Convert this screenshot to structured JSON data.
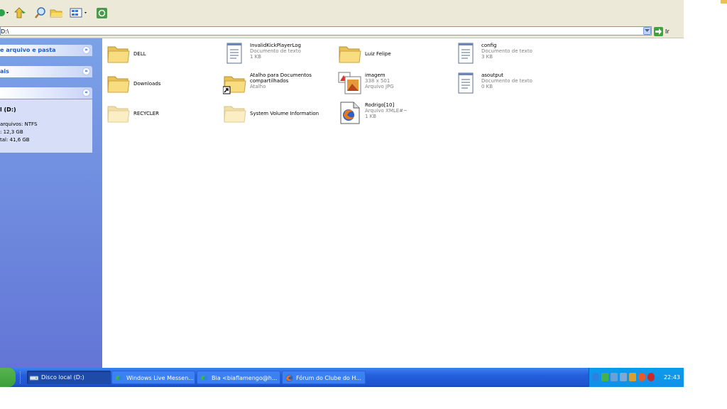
{
  "address": {
    "value": "D:\\",
    "go_label": "Ir"
  },
  "taskpane": {
    "panel1": "e arquivo e pasta",
    "panel2": "ais",
    "details": {
      "title": "l (D:)",
      "lines": [
        "arquivos: NTFS",
        ": 12,3 GB",
        "tal: 41,6 GB"
      ]
    }
  },
  "files": [
    {
      "name": "DELL",
      "icon": "folder-icon"
    },
    {
      "name": "Downloads",
      "icon": "folder-icon"
    },
    {
      "name": "RECYCLER",
      "icon": "folder-icon-faded"
    },
    {
      "name": "InvalidKickPlayerLog",
      "type": "Documento de texto",
      "size": "1 KB",
      "icon": "text-document-icon"
    },
    {
      "name": "Atalho para Documentos",
      "name2": "compartilhados",
      "type": "Atalho",
      "icon": "shortcut-folder-icon"
    },
    {
      "name": "System Volume Information",
      "icon": "folder-icon-faded"
    },
    {
      "name": "Luiz Felipe",
      "icon": "folder-icon"
    },
    {
      "name": "imagem",
      "type": "338 x 501",
      "size": "Arquivo JPG",
      "icon": "jpg-image-icon"
    },
    {
      "name": "Rodrigo[10]",
      "type": "Arquivo XMLE#~",
      "size": "1 KB",
      "icon": "firefox-document-icon"
    },
    {
      "name": "config",
      "type": "Documento de texto",
      "size": "3 KB",
      "icon": "text-document-icon"
    },
    {
      "name": "asoutput",
      "type": "Documento de texto",
      "size": "0 KB",
      "icon": "text-document-icon"
    }
  ],
  "taskbar": {
    "tasks": [
      {
        "label": "Disco local (D:)"
      },
      {
        "label": "Windows Live Messen..."
      },
      {
        "label": "Bia <biaflamengo@h..."
      },
      {
        "label": "Fórum do Clube do H..."
      }
    ],
    "clock": "22:43"
  },
  "colors": {
    "taskbar": "#245edb",
    "taskpane": "#6f8fdf",
    "tray": "#0f95eb",
    "folder": "#f5d97a"
  }
}
